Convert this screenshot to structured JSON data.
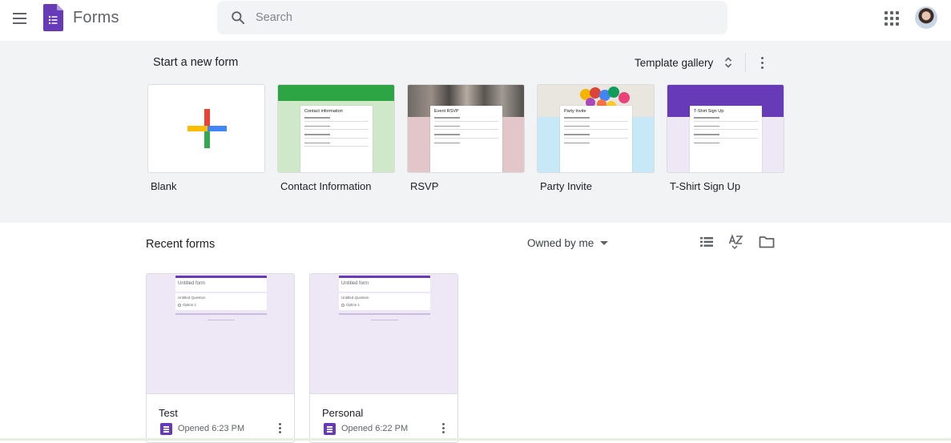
{
  "header": {
    "app_name": "Forms",
    "search_placeholder": "Search",
    "icons": [
      "menu-icon",
      "forms-logo",
      "search-icon",
      "apps-grid-icon",
      "avatar"
    ]
  },
  "templates": {
    "title": "Start a new form",
    "gallery_label": "Template gallery",
    "items": [
      {
        "label": "Blank",
        "preview_title": ""
      },
      {
        "label": "Contact Information",
        "preview_title": "Contact information"
      },
      {
        "label": "RSVP",
        "preview_title": "Event RSVP"
      },
      {
        "label": "Party Invite",
        "preview_title": "Party Invite"
      },
      {
        "label": "T-Shirt Sign Up",
        "preview_title": "T-Shirt Sign Up"
      }
    ]
  },
  "recent": {
    "title": "Recent forms",
    "owner_filter": "Owned by me",
    "forms": [
      {
        "name": "Test",
        "opened": "Opened 6:23 PM",
        "preview_title": "Untitled form",
        "question": "Untitled Question",
        "option": "Option 1"
      },
      {
        "name": "Personal",
        "opened": "Opened 6:22 PM",
        "preview_title": "Untitled form",
        "question": "Untitled Question",
        "option": "Option 1"
      }
    ]
  },
  "colors": {
    "forms_purple": "#673ab7",
    "band_bg": "#f1f3f4",
    "contact_green": "#2da544",
    "rsvp_pink": "#e3c6c9",
    "party_blue": "#c7e8f7",
    "tshirt_purple": "#673ab7"
  }
}
